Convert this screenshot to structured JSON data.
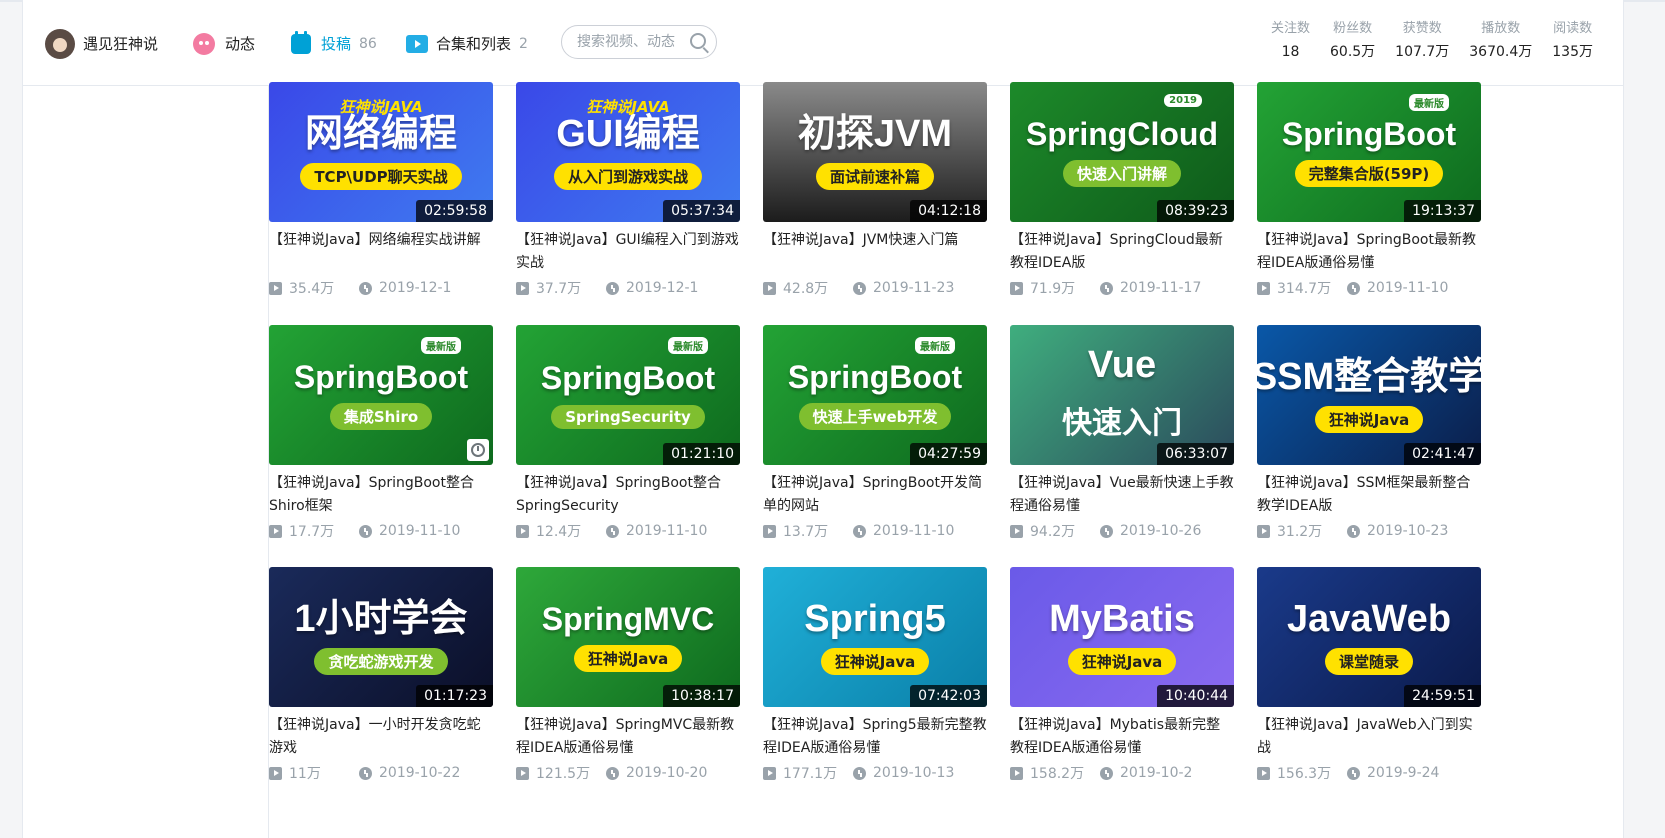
{
  "nav": {
    "username": "遇见狂神说",
    "dynamic_label": "动态",
    "contrib_label": "投稿",
    "contrib_count": "86",
    "collection_label": "合集和列表",
    "collection_count": "2",
    "search_placeholder": "搜索视频、动态"
  },
  "stats": [
    {
      "label": "关注数",
      "value": "18"
    },
    {
      "label": "粉丝数",
      "value": "60.5万"
    },
    {
      "label": "获赞数",
      "value": "107.7万"
    },
    {
      "label": "播放数",
      "value": "3670.4万"
    },
    {
      "label": "阅读数",
      "value": "135万"
    }
  ],
  "videos": [
    {
      "title": "【狂神说Java】网络编程实战讲解",
      "views": "35.4万",
      "date": "2019-12-1",
      "duration": "02:59:58",
      "thumb_text": "网络编程",
      "thumb_sub": "TCP\\UDP聊天实战",
      "thumb_brand": "狂神说JAVA"
    },
    {
      "title": "【狂神说Java】GUI编程入门到游戏实战",
      "views": "37.7万",
      "date": "2019-12-1",
      "duration": "05:37:34",
      "thumb_text": "GUI编程",
      "thumb_sub": "从入门到游戏实战",
      "thumb_brand": "狂神说JAVA"
    },
    {
      "title": "【狂神说Java】JVM快速入门篇",
      "views": "42.8万",
      "date": "2019-11-23",
      "duration": "04:12:18",
      "thumb_text": "初探JVM",
      "thumb_sub": "面试前速补篇",
      "thumb_brand": ""
    },
    {
      "title": "【狂神说Java】SpringCloud最新教程IDEA版",
      "views": "71.9万",
      "date": "2019-11-17",
      "duration": "08:39:23",
      "thumb_text": "SpringCloud",
      "thumb_sub": "快速入门讲解",
      "thumb_brand": "",
      "thumb_badge": "2019"
    },
    {
      "title": "【狂神说Java】SpringBoot最新教程IDEA版通俗易懂",
      "views": "314.7万",
      "date": "2019-11-10",
      "duration": "19:13:37",
      "thumb_text": "SpringBoot",
      "thumb_sub": "完整集合版(59P)",
      "thumb_brand": "",
      "thumb_badge": "最新版"
    },
    {
      "title": "【狂神说Java】SpringBoot整合Shiro框架",
      "views": "17.7万",
      "date": "2019-11-10",
      "duration": "",
      "thumb_text": "SpringBoot",
      "thumb_sub": "集成Shiro",
      "thumb_brand": "",
      "thumb_badge": "最新版"
    },
    {
      "title": "【狂神说Java】SpringBoot整合SpringSecurity",
      "views": "12.4万",
      "date": "2019-11-10",
      "duration": "01:21:10",
      "thumb_text": "SpringBoot",
      "thumb_sub": "SpringSecurity",
      "thumb_brand": "",
      "thumb_badge": "最新版"
    },
    {
      "title": "【狂神说Java】SpringBoot开发简单的网站",
      "views": "13.7万",
      "date": "2019-11-10",
      "duration": "04:27:59",
      "thumb_text": "SpringBoot",
      "thumb_sub": "快速上手web开发",
      "thumb_brand": "",
      "thumb_badge": "最新版"
    },
    {
      "title": "【狂神说Java】Vue最新快速上手教程通俗易懂",
      "views": "94.2万",
      "date": "2019-10-26",
      "duration": "06:33:07",
      "thumb_text": "Vue",
      "thumb_sub": "快速入门",
      "thumb_brand": ""
    },
    {
      "title": "【狂神说Java】SSM框架最新整合教学IDEA版",
      "views": "31.2万",
      "date": "2019-10-23",
      "duration": "02:41:47",
      "thumb_text": "SSM整合教学",
      "thumb_sub": "狂神说Java",
      "thumb_brand": ""
    },
    {
      "title": "【狂神说Java】一小时开发贪吃蛇游戏",
      "views": "11万",
      "date": "2019-10-22",
      "duration": "01:17:23",
      "thumb_text": "1小时学会",
      "thumb_sub": "贪吃蛇游戏开发",
      "thumb_brand": ""
    },
    {
      "title": "【狂神说Java】SpringMVC最新教程IDEA版通俗易懂",
      "views": "121.5万",
      "date": "2019-10-20",
      "duration": "10:38:17",
      "thumb_text": "SpringMVC",
      "thumb_sub": "狂神说Java",
      "thumb_brand": ""
    },
    {
      "title": "【狂神说Java】Spring5最新完整教程IDEA版通俗易懂",
      "views": "177.1万",
      "date": "2019-10-13",
      "duration": "07:42:03",
      "thumb_text": "Spring5",
      "thumb_sub": "狂神说Java",
      "thumb_brand": ""
    },
    {
      "title": "【狂神说Java】Mybatis最新完整教程IDEA版通俗易懂",
      "views": "158.2万",
      "date": "2019-10-2",
      "duration": "10:40:44",
      "thumb_text": "MyBatis",
      "thumb_sub": "狂神说Java",
      "thumb_brand": ""
    },
    {
      "title": "【狂神说Java】JavaWeb入门到实战",
      "views": "156.3万",
      "date": "2019-9-24",
      "duration": "24:59:51",
      "thumb_text": "JavaWeb",
      "thumb_sub": "课堂随录",
      "thumb_brand": ""
    }
  ],
  "colors": {
    "accent": "#00a1d6",
    "muted": "#99a2aa"
  }
}
